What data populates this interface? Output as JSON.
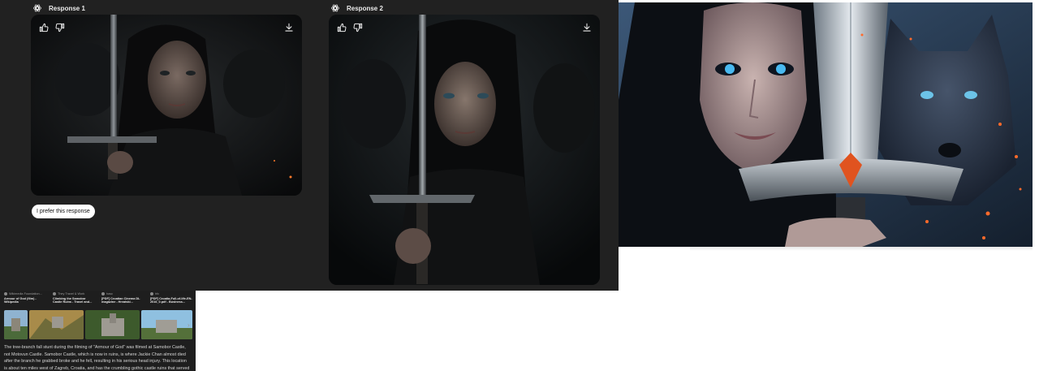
{
  "compare": {
    "response1_label": "Response 1",
    "response2_label": "Response 2",
    "prefer_label": "I prefer this response"
  },
  "icons": {
    "model": "openai-icon",
    "like": "thumbs-up-icon",
    "dislike": "thumbs-down-icon",
    "download": "download-icon",
    "next": "chevron-right-icon"
  },
  "sources": {
    "cards": [
      {
        "site": "Wikimedia Foundation...",
        "title": "Armour of God (film) - Wikipedia"
      },
      {
        "site": "They Travel & Work",
        "title": "Climbing the Samobor Castle Ruins - Travel and..."
      },
      {
        "site": "hasc",
        "title": "[PDF] Croatian Cinema DL magazine - Hrvatski..."
      },
      {
        "site": "hfc",
        "title": "[PDF] Croatia-Full-of-life-EN-2016_0.pdf - Business..."
      }
    ],
    "answer": "The tree-branch fall stunt during the filming of \"Armour of God\" was filmed at Samobor Castle, not Motovun Castle. Samobor Castle, which is now in ruins, is where Jackie Chan almost died after the branch he grabbed broke and he fell, resulting in his serious head injury. This location is about ten miles west of Zagreb, Croatia, and has the crumbling gothic castle ruins that served as"
  },
  "colors": {
    "panel_bg": "#212121",
    "text": "#ececec",
    "accent_eye": "#49b9f0",
    "ember": "#ff6a2a"
  }
}
